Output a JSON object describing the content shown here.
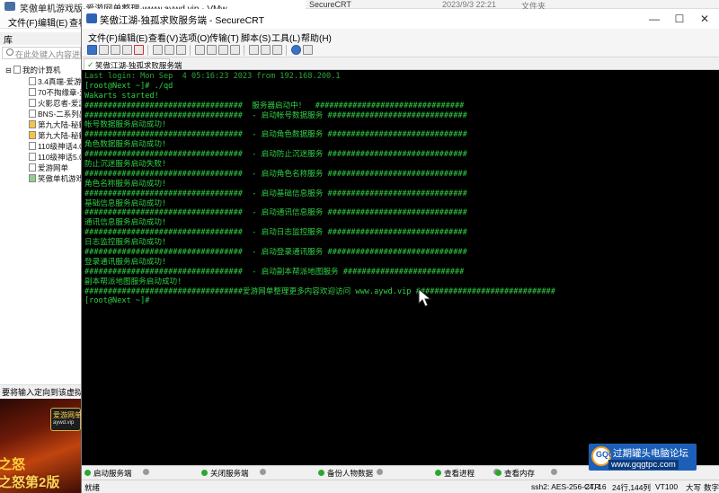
{
  "vmware": {
    "title": "笑傲单机游戏版-爱游网单整理-www.aywd.vip - VMw",
    "menu": [
      "文件(F)",
      "编辑(E)",
      "查看"
    ],
    "library_title": "库",
    "search_placeholder": "在此处键入内容进行搜",
    "tree_root": "我的计算机",
    "tree_items": [
      "3.4真端-爱游",
      "70不掏缘章-爱",
      "火影忍者-爱游",
      "BNS-二系列出",
      "第九大陆-秘籍",
      "第九大陆-秘籍",
      "110级神话4.0",
      "110级神话5.0",
      "爱游网单",
      "笑傲单机游戏"
    ],
    "status": "要将输入定向到该虚拟机,"
  },
  "explorer_strip": {
    "item": "SecureCRT",
    "date": "2023/9/3 22:21",
    "type": "文件夹"
  },
  "ad": {
    "logo": "爱游网单",
    "logo_sub": "aywd.vip",
    "text1": "之怒",
    "text2": "之怒第2版"
  },
  "securecrt": {
    "title": "笑傲江湖-独孤求败服务端 - SecureCRT",
    "controls": {
      "minimize": "—",
      "maximize": "☐",
      "close": "✕"
    },
    "menu": [
      "文件(F)",
      "编辑(E)",
      "查看(V)",
      "选项(O)",
      "传输(T)",
      "脚本(S)",
      "工具(L)",
      "帮助(H)"
    ],
    "tab_label": "笑傲江湖-独孤求败服务端",
    "terminal_lines": [
      "Last login: Mon Sep  4 05:16:23 2023 from 192.168.200.1",
      "[root@Next ~]# ./qd",
      "Wakarts started!",
      "##################################  服务器启动中！  ################################",
      "##################################  - 启动帐号数据服务 ##############################",
      "帐号数据服务启动成功!",
      "##################################  - 启动角色数据服务 ##############################",
      "角色数据服务启动成功!",
      "##################################  - 启动防止沉迷服务 ##############################",
      "防止沉迷服务启动失败!",
      "##################################  - 启动角色名称服务 ##############################",
      "角色名称服务启动成功!",
      "##################################  - 启动基础信息服务 ##############################",
      "基础信息服务启动成功!",
      "##################################  - 启动通讯信息服务 ##############################",
      "通讯信息服务启动成功!",
      "##################################  - 启动日志监控服务 ##############################",
      "日志监控服务启动成功!",
      "##################################  - 启动登录通讯服务 ##############################",
      "登录通讯服务启动成功!",
      "##################################  - 启动副本帮派地图服务 ##########################",
      "副本帮派地图服务启动成功!",
      "##################################爱游网单整理更多内容欢迎访问 www.aywd.vip ##############################",
      "[root@Next ~]# "
    ],
    "buttons": [
      {
        "label": "启动服务端",
        "active": true
      },
      {
        "label": "",
        "active": false
      },
      {
        "label": "关闭服务端",
        "active": true
      },
      {
        "label": "",
        "active": false
      },
      {
        "label": "备份人物数据",
        "active": true
      },
      {
        "label": "",
        "active": false
      },
      {
        "label": "查看进程",
        "active": true
      },
      {
        "label": "",
        "active": false
      },
      {
        "label": "查看内存",
        "active": true
      },
      {
        "label": "",
        "active": false
      }
    ],
    "status": {
      "ready": "就绪",
      "cipher": "ssh2: AES-256-CTR",
      "pos": "24, 16",
      "size": "24行,144列",
      "term": "VT100",
      "caps": "大写",
      "num": "数字"
    }
  },
  "watermark": {
    "badge": "GQG",
    "title": "过期罐头电脑论坛",
    "url": "www.gqgtpc.com"
  }
}
